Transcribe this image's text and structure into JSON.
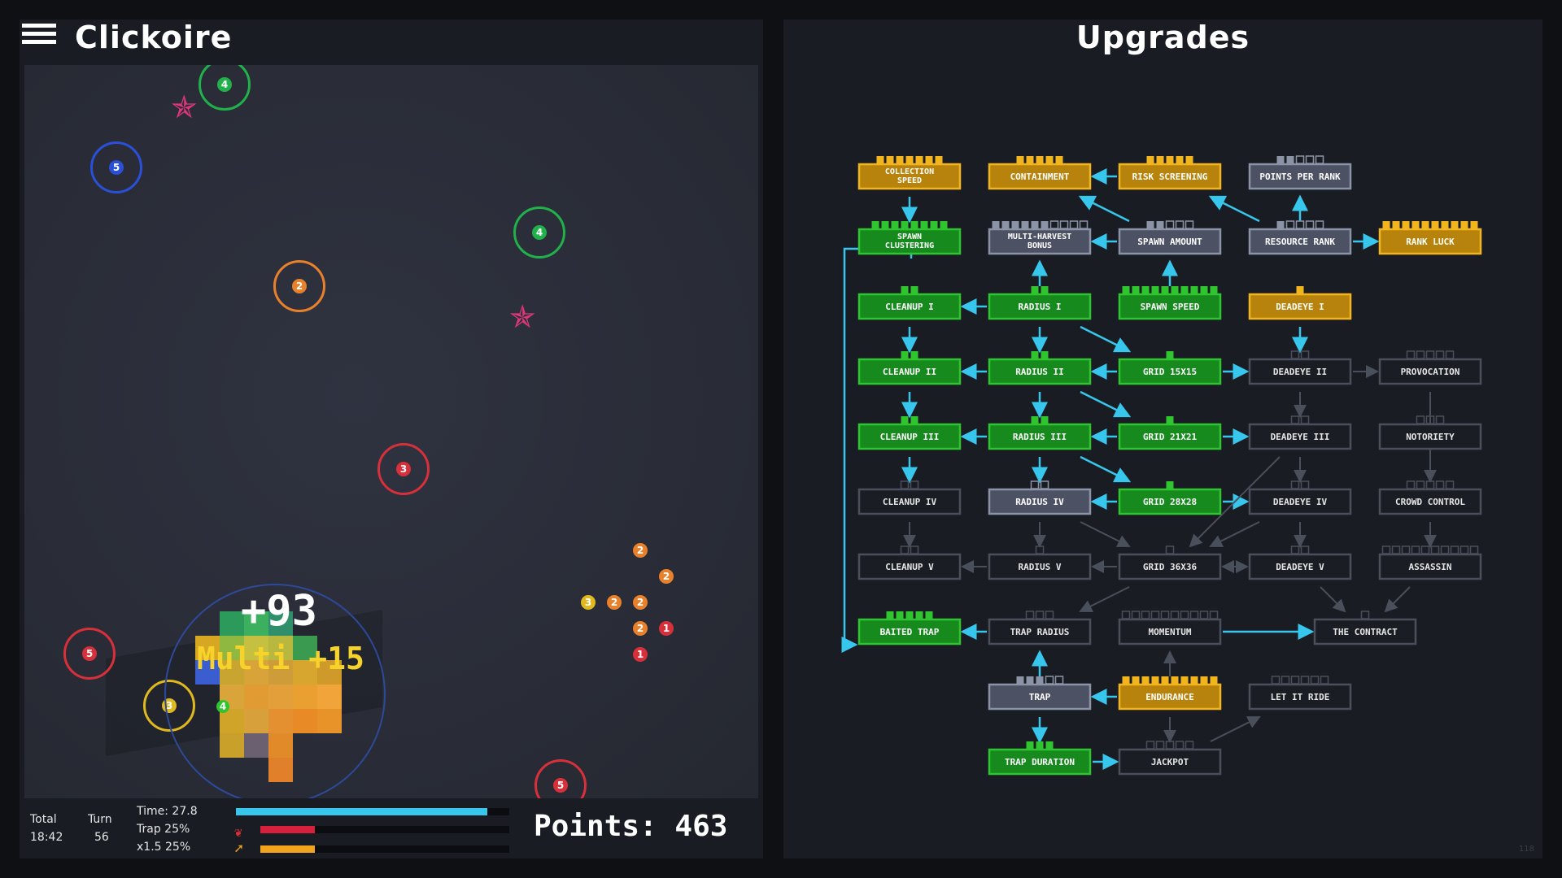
{
  "left": {
    "title": "Clickoire",
    "hud": {
      "total_label": "Total",
      "total_value": "18:42",
      "turn_label": "Turn",
      "turn_value": "56",
      "time_text": "Time: 27.8",
      "trap_text": "Trap 25%",
      "multi_text": "x1.5 25%",
      "time_progress": 0.92,
      "trap_progress": 0.22,
      "multi_progress": 0.22,
      "points_text": "Points: 463"
    },
    "floating": {
      "score_popup": "+93",
      "multi_popup": "Multi +15"
    },
    "rings": [
      {
        "color": "#21b14a",
        "value": "4"
      },
      {
        "color": "#2b50d8",
        "value": "5"
      },
      {
        "color": "#21b14a",
        "value": "4"
      },
      {
        "color": "#e8822a",
        "value": "2"
      },
      {
        "color": "#d8303a",
        "value": "3"
      },
      {
        "color": "#d8303a",
        "value": "5"
      },
      {
        "color": "#e0b820",
        "value": "3"
      },
      {
        "color": "#d8303a",
        "value": "5"
      }
    ],
    "dots": [
      "2",
      "2",
      "3",
      "2",
      "2",
      "2",
      "1",
      "1",
      "4"
    ]
  },
  "right": {
    "title": "Upgrades",
    "version": "118",
    "nodes": [
      {
        "id": "collection_speed",
        "label": "COLLECTION SPEED",
        "state": "gold",
        "pips": 7,
        "filled": 7
      },
      {
        "id": "containment",
        "label": "CONTAINMENT",
        "state": "gold",
        "pips": 5,
        "filled": 5
      },
      {
        "id": "risk_screening",
        "label": "RISK SCREENING",
        "state": "gold",
        "pips": 5,
        "filled": 5
      },
      {
        "id": "points_per_rank",
        "label": "POINTS PER RANK",
        "state": "gray",
        "pips": 5,
        "filled": 2
      },
      {
        "id": "spawn_clustering",
        "label": "SPAWN CLUSTERING",
        "state": "green",
        "pips": 8,
        "filled": 8
      },
      {
        "id": "multi_harvest",
        "label": "MULTI-HARVEST BONUS",
        "state": "gray",
        "pips": 10,
        "filled": 6
      },
      {
        "id": "spawn_amount",
        "label": "SPAWN AMOUNT",
        "state": "gray",
        "pips": 5,
        "filled": 2
      },
      {
        "id": "resource_rank",
        "label": "RESOURCE RANK",
        "state": "gray",
        "pips": 5,
        "filled": 1
      },
      {
        "id": "rank_luck",
        "label": "RANK LUCK",
        "state": "gold",
        "pips": 10,
        "filled": 10
      },
      {
        "id": "cleanup_1",
        "label": "CLEANUP I",
        "state": "green",
        "pips": 2,
        "filled": 2
      },
      {
        "id": "radius_1",
        "label": "RADIUS I",
        "state": "green",
        "pips": 2,
        "filled": 2
      },
      {
        "id": "spawn_speed",
        "label": "SPAWN SPEED",
        "state": "green",
        "pips": 10,
        "filled": 10
      },
      {
        "id": "deadeye_1",
        "label": "DEADEYE I",
        "state": "gold",
        "pips": 1,
        "filled": 1
      },
      {
        "id": "cleanup_2",
        "label": "CLEANUP II",
        "state": "green",
        "pips": 2,
        "filled": 2
      },
      {
        "id": "radius_2",
        "label": "RADIUS II",
        "state": "green",
        "pips": 2,
        "filled": 2
      },
      {
        "id": "grid_15",
        "label": "GRID 15X15",
        "state": "green",
        "pips": 1,
        "filled": 1
      },
      {
        "id": "deadeye_2",
        "label": "DEADEYE II",
        "state": "dark",
        "pips": 2,
        "filled": 0
      },
      {
        "id": "provocation",
        "label": "PROVOCATION",
        "state": "dark",
        "pips": 5,
        "filled": 0
      },
      {
        "id": "cleanup_3",
        "label": "CLEANUP III",
        "state": "green",
        "pips": 2,
        "filled": 2
      },
      {
        "id": "radius_3",
        "label": "RADIUS III",
        "state": "green",
        "pips": 2,
        "filled": 2
      },
      {
        "id": "grid_21",
        "label": "GRID 21X21",
        "state": "green",
        "pips": 1,
        "filled": 1
      },
      {
        "id": "deadeye_3",
        "label": "DEADEYE III",
        "state": "dark",
        "pips": 2,
        "filled": 0
      },
      {
        "id": "notoriety",
        "label": "NOTORIETY",
        "state": "dark",
        "pips": 3,
        "filled": 0
      },
      {
        "id": "cleanup_4",
        "label": "CLEANUP IV",
        "state": "dark",
        "pips": 2,
        "filled": 0
      },
      {
        "id": "radius_4",
        "label": "RADIUS IV",
        "state": "gray",
        "pips": 2,
        "filled": 0
      },
      {
        "id": "grid_28",
        "label": "GRID 28X28",
        "state": "green",
        "pips": 1,
        "filled": 1
      },
      {
        "id": "deadeye_4",
        "label": "DEADEYE IV",
        "state": "dark",
        "pips": 2,
        "filled": 0
      },
      {
        "id": "crowd_control",
        "label": "CROWD CONTROL",
        "state": "dark",
        "pips": 5,
        "filled": 0
      },
      {
        "id": "cleanup_5",
        "label": "CLEANUP V",
        "state": "dark",
        "pips": 2,
        "filled": 0
      },
      {
        "id": "radius_5",
        "label": "RADIUS V",
        "state": "dark",
        "pips": 1,
        "filled": 0
      },
      {
        "id": "grid_36",
        "label": "GRID 36X36",
        "state": "dark",
        "pips": 1,
        "filled": 0
      },
      {
        "id": "deadeye_5",
        "label": "DEADEYE V",
        "state": "dark",
        "pips": 2,
        "filled": 0
      },
      {
        "id": "assassin",
        "label": "ASSASSIN",
        "state": "dark",
        "pips": 10,
        "filled": 0
      },
      {
        "id": "baited_trap",
        "label": "BAITED TRAP",
        "state": "green",
        "pips": 5,
        "filled": 5
      },
      {
        "id": "trap_radius",
        "label": "TRAP RADIUS",
        "state": "dark",
        "pips": 3,
        "filled": 0
      },
      {
        "id": "momentum",
        "label": "MOMENTUM",
        "state": "dark",
        "pips": 10,
        "filled": 0
      },
      {
        "id": "the_contract",
        "label": "THE CONTRACT",
        "state": "dark",
        "pips": 1,
        "filled": 0
      },
      {
        "id": "trap",
        "label": "TRAP",
        "state": "gray",
        "pips": 5,
        "filled": 3
      },
      {
        "id": "endurance",
        "label": "ENDURANCE",
        "state": "gold",
        "pips": 10,
        "filled": 10
      },
      {
        "id": "let_it_ride",
        "label": "LET IT RIDE",
        "state": "dark",
        "pips": 6,
        "filled": 0
      },
      {
        "id": "trap_duration",
        "label": "TRAP DURATION",
        "state": "green",
        "pips": 3,
        "filled": 3
      },
      {
        "id": "jackpot",
        "label": "JACKPOT",
        "state": "dark",
        "pips": 5,
        "filled": 0
      }
    ],
    "colors": {
      "gold": "#f2b51e",
      "green": "#2ec52e",
      "gray": "#8b93a7",
      "dark": "#4a4f5c",
      "arrow": "#38c7ec",
      "arrow_dim": "#4a4f5c"
    }
  }
}
